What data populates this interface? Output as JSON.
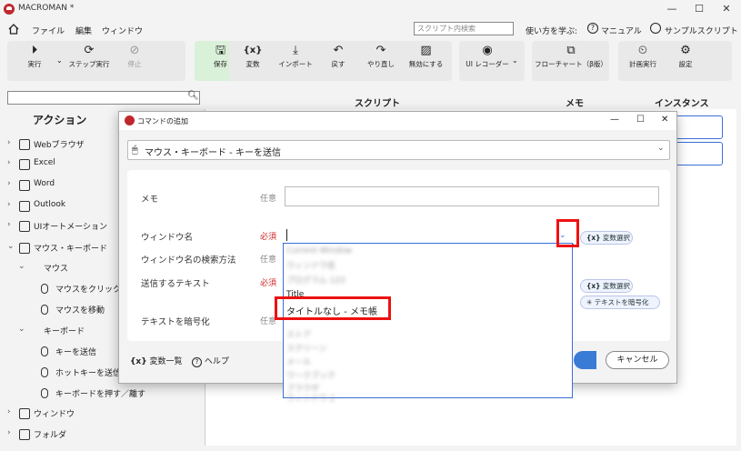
{
  "window": {
    "title": "MACROMAN *",
    "minimize": "—",
    "maximize": "☐",
    "close": "✕"
  },
  "menu": {
    "file": "ファイル",
    "edit": "編集",
    "window": "ウィンドウ"
  },
  "search": {
    "placeholder": "スクリプト内検索"
  },
  "help_links": {
    "learn": "使い方を学ぶ:",
    "manual": "マニュアル",
    "sample": "サンプルスクリプト"
  },
  "toolbar": {
    "run": "実行",
    "step_run": "ステップ実行",
    "stop": "停止",
    "save": "保存",
    "variable": "変数",
    "import": "インポート",
    "undo": "戻す",
    "redo": "やり直し",
    "disable": "無効にする",
    "ui_recorder": "UI レコーダー",
    "flowchart": "フローチャート（β版）",
    "schedule": "計画実行",
    "settings": "設定"
  },
  "left_panel": {
    "header": "アクション",
    "items": [
      {
        "label": "Webブラウザ",
        "level": 0,
        "expanded": false
      },
      {
        "label": "Excel",
        "level": 0,
        "expanded": false
      },
      {
        "label": "Word",
        "level": 0,
        "expanded": false
      },
      {
        "label": "Outlook",
        "level": 0,
        "expanded": false
      },
      {
        "label": "UIオートメーション",
        "level": 0,
        "expanded": false
      },
      {
        "label": "マウス・キーボード",
        "level": 0,
        "expanded": true
      },
      {
        "label": "マウス",
        "level": 1,
        "expanded": true
      },
      {
        "label": "マウスをクリック",
        "level": 2
      },
      {
        "label": "マウスを移動",
        "level": 2
      },
      {
        "label": "キーボード",
        "level": 1,
        "expanded": true
      },
      {
        "label": "キーを送信",
        "level": 2
      },
      {
        "label": "ホットキーを送信",
        "level": 2
      },
      {
        "label": "キーボードを押す／離す",
        "level": 2
      },
      {
        "label": "ウィンドウ",
        "level": 0,
        "expanded": false
      },
      {
        "label": "フォルダ",
        "level": 0,
        "expanded": false
      }
    ]
  },
  "columns": {
    "script": "スクリプト",
    "memo": "メモ",
    "instance": "インスタンス"
  },
  "dialog": {
    "title": "コマンドの追加",
    "command": "マウス・キーボード - キーを送信",
    "fields": {
      "memo": {
        "label": "メモ",
        "tag": "任意"
      },
      "window_name": {
        "label": "ウィンドウ名",
        "tag": "必須"
      },
      "search_method": {
        "label": "ウィンドウ名の検索方法",
        "tag": "任意"
      },
      "send_text": {
        "label": "送信するテキスト",
        "tag": "必須"
      },
      "encrypt": {
        "label": "テキストを暗号化",
        "tag": "任意"
      }
    },
    "var_select": "変数選択",
    "var_select2": "変数選択",
    "encrypt_btn": "テキストを暗号化",
    "var_list": "変数一覧",
    "help": "ヘルプ",
    "cancel": "キャンセル"
  },
  "dropdown": {
    "blurred_items": [
      "Current Window",
      "ウィンドウ名",
      "プログラム 123",
      "ストア",
      "スクリーン",
      "メール",
      "ワークブック",
      "ブラウザ",
      "ウィンドウ 2",
      "ファイル"
    ],
    "title_item": "Title",
    "selected_item": "タイトルなし - メモ帳"
  },
  "colors": {
    "highlight": "#e11111",
    "accent": "#3a7bd5",
    "brand": "#c0282d"
  }
}
